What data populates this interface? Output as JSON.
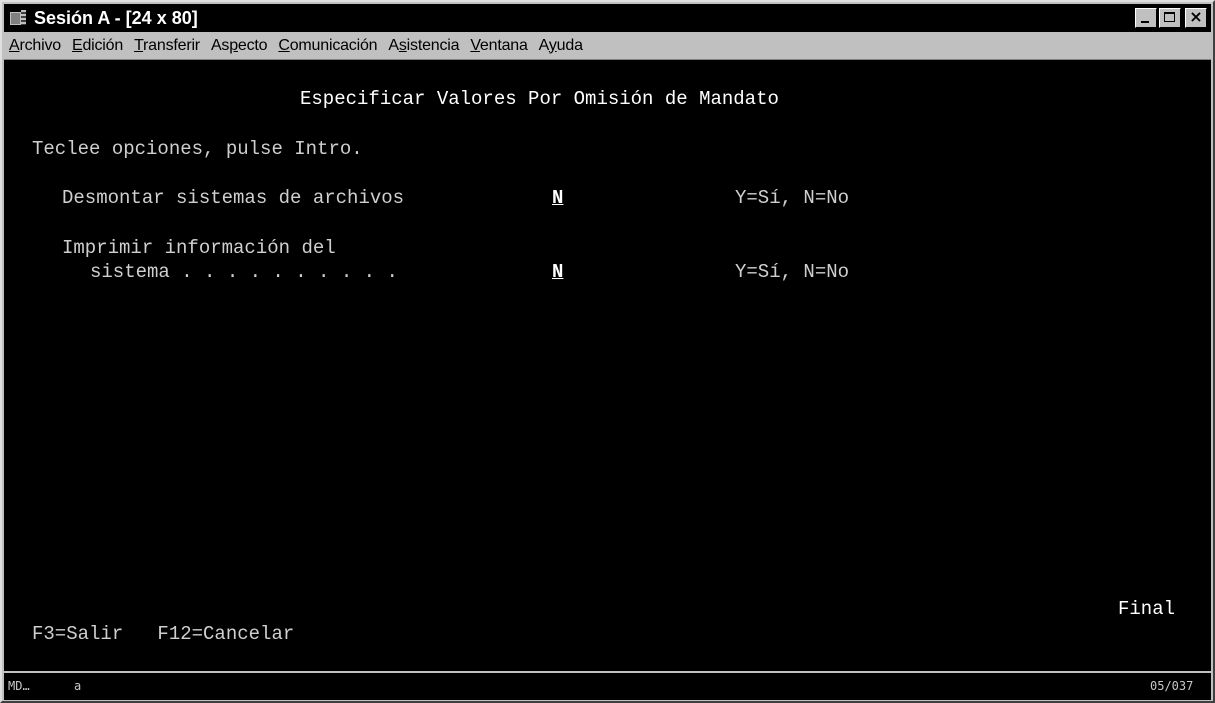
{
  "window": {
    "title": "Sesión A - [24 x 80]",
    "icon": "terminal-session-icon"
  },
  "menu": [
    {
      "label": "Archivo",
      "mnemonic_index": 0
    },
    {
      "label": "Edición",
      "mnemonic_index": 0
    },
    {
      "label": "Transferir",
      "mnemonic_index": 0
    },
    {
      "label": "Aspecto",
      "mnemonic_index": 2
    },
    {
      "label": "Comunicación",
      "mnemonic_index": 0
    },
    {
      "label": "Asistencia",
      "mnemonic_index": 1
    },
    {
      "label": "Ventana",
      "mnemonic_index": 0
    },
    {
      "label": "Ayuda",
      "mnemonic_index": 1
    }
  ],
  "screen": {
    "title": "Especificar Valores Por Omisión de Mandato",
    "instructions": "Teclee opciones, pulse Intro.",
    "fields": [
      {
        "label_line1": "Desmontar sistemas de archivos",
        "value": "N",
        "hint": "Y=Sí, N=No"
      },
      {
        "label_line1": "Imprimir información del",
        "label_line2": "sistema . . . . . . . . . .",
        "value": "N",
        "hint": "Y=Sí, N=No"
      }
    ],
    "more_indicator": "Final",
    "function_keys": "F3=Salir   F12=Cancelar"
  },
  "status": {
    "left": "MD…",
    "indicator": "a",
    "cursor_pos": "05/037"
  },
  "colors": {
    "terminal_bg": "#000000",
    "terminal_fg": "#cfcfcf",
    "title_bar": "#000000",
    "chrome": "#c0c0c0"
  }
}
